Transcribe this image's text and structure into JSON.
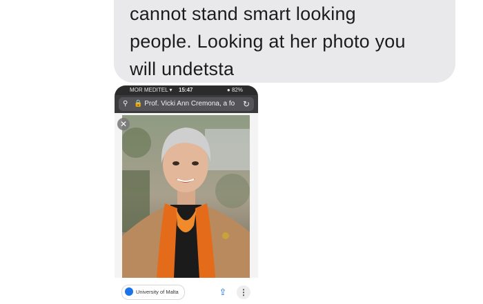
{
  "message": {
    "lines": [
      "cannot stand smart looking",
      "people. Looking at her photo you",
      "will undetsta"
    ]
  },
  "screenshot": {
    "status_bar": {
      "carrier": "MOR MEDITEL",
      "time": "15:47",
      "battery": "82%"
    },
    "address_bar": {
      "text": "Prof. Vicki Ann Cremona, a fo"
    },
    "source": {
      "label": "University of Malta",
      "icon": "globe-icon"
    },
    "actions": {
      "share_icon": "share-icon",
      "more_icon": "more-vert-icon",
      "close_icon": "close-icon"
    }
  }
}
